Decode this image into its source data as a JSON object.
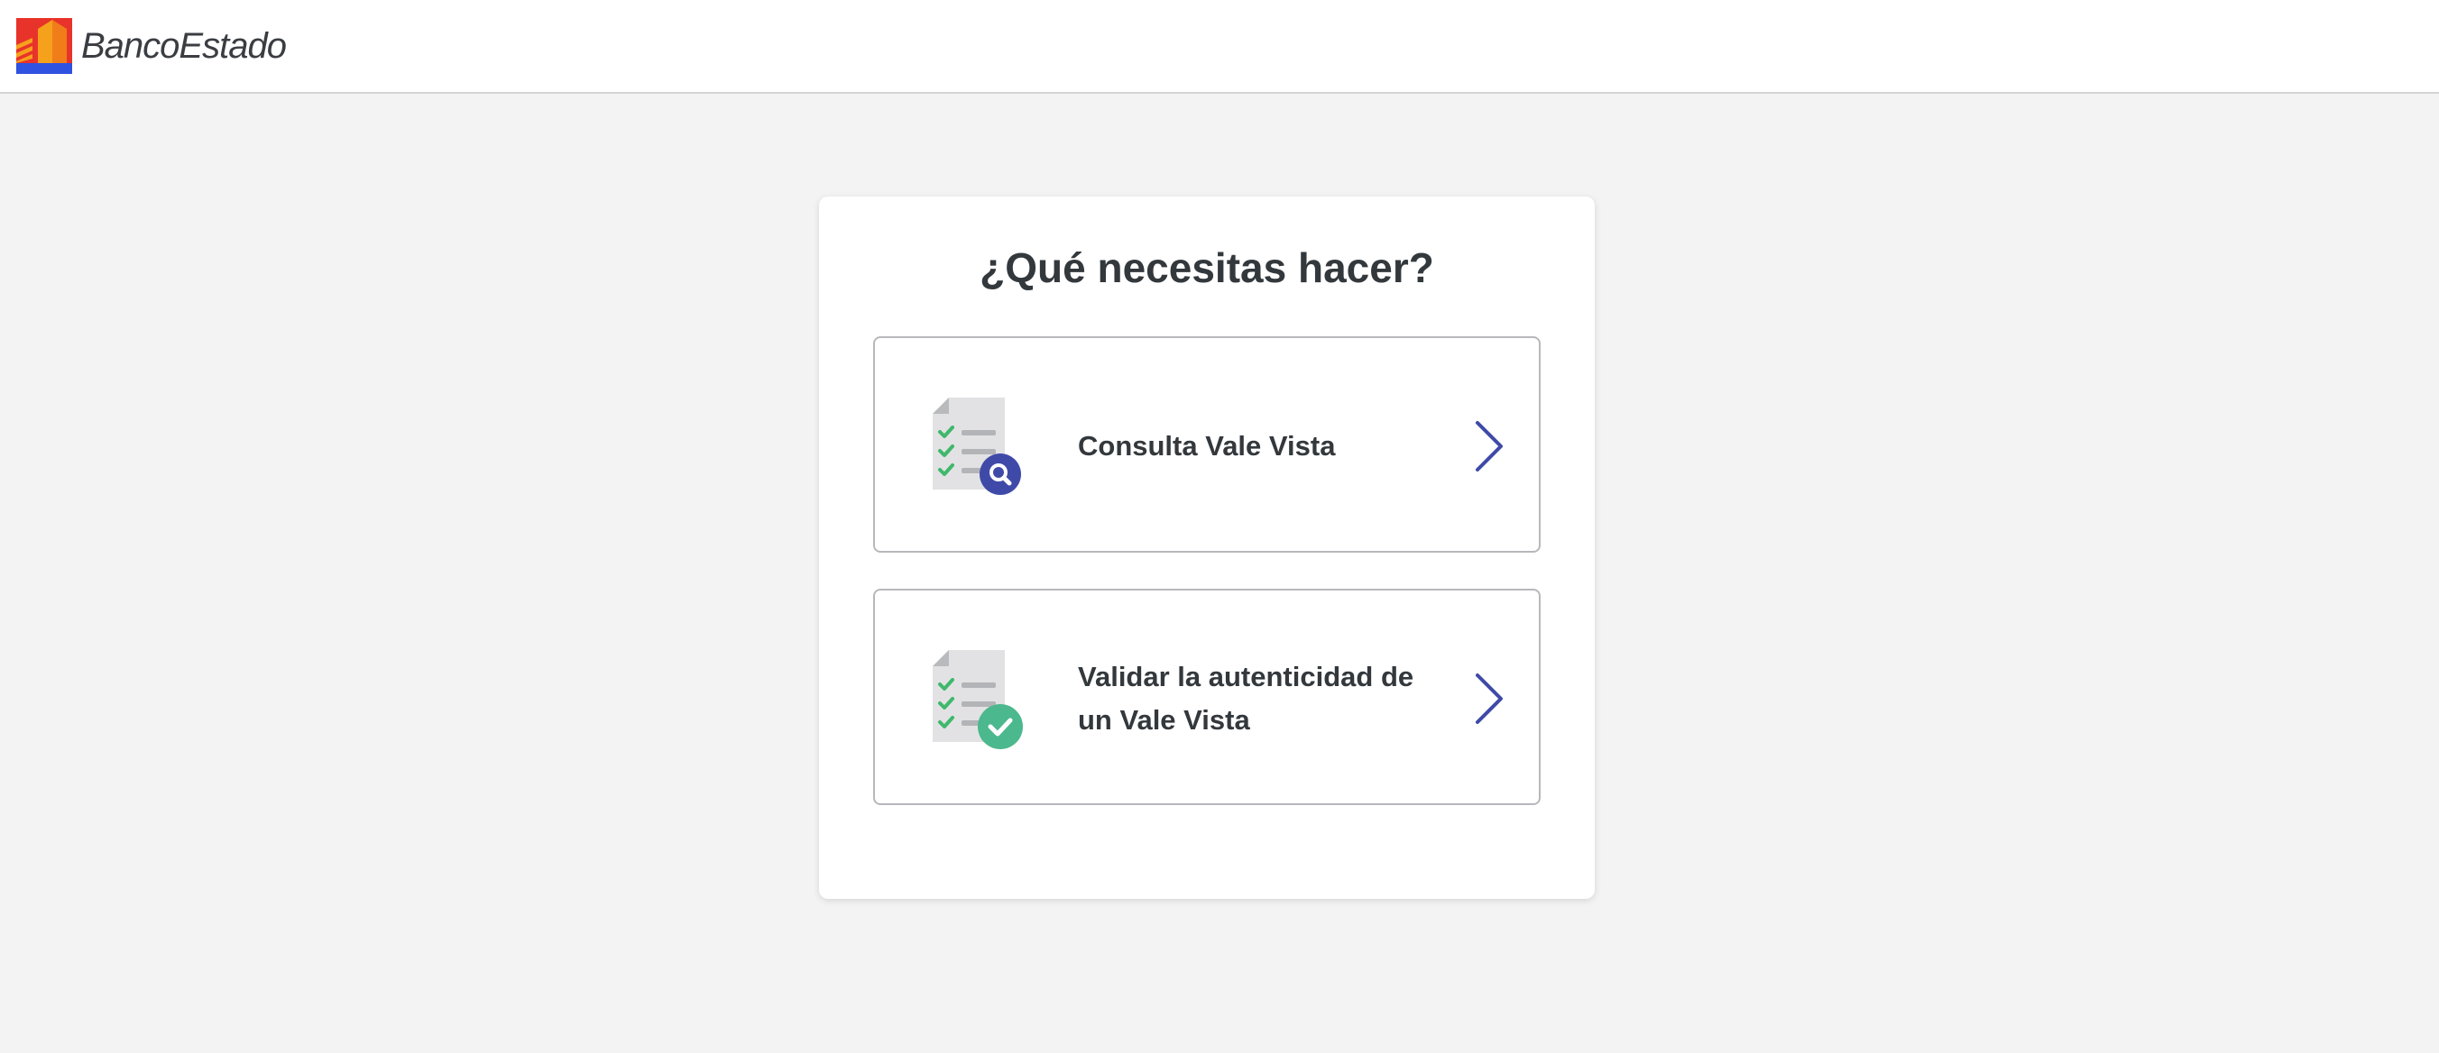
{
  "header": {
    "logo_text": "BancoEstado",
    "brand_colors": {
      "orange": "#f26b1d",
      "red": "#e8332a",
      "blue": "#2f52e0"
    }
  },
  "main": {
    "title": "¿Qué necesitas hacer?",
    "options": [
      {
        "label": "Consulta Vale Vista",
        "icon": "document-search-icon",
        "badge_color": "#3f4aa8"
      },
      {
        "label": "Validar la autenticidad de un Vale Vista",
        "icon": "document-check-icon",
        "badge_color": "#4cb88d"
      }
    ],
    "accent_color": "#3f4aa8"
  }
}
